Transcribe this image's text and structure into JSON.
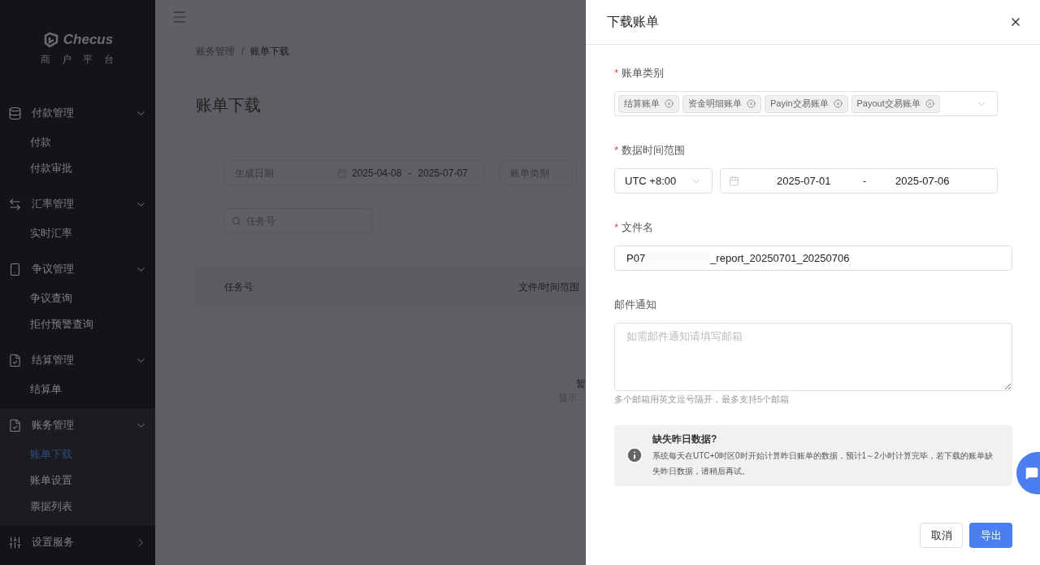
{
  "sidebar": {
    "logo": "Checus",
    "subtitle": "商户平台",
    "groups": [
      {
        "label": "付款管理",
        "expanded": true,
        "items": [
          {
            "label": "付款",
            "selected": false
          },
          {
            "label": "付款审批",
            "selected": false
          }
        ]
      },
      {
        "label": "汇率管理",
        "expanded": true,
        "items": [
          {
            "label": "实时汇率",
            "selected": false
          }
        ]
      },
      {
        "label": "争议管理",
        "expanded": true,
        "items": [
          {
            "label": "争议查询",
            "selected": false
          },
          {
            "label": "拒付预警查询",
            "selected": false
          }
        ]
      },
      {
        "label": "结算管理",
        "expanded": true,
        "items": [
          {
            "label": "结算单",
            "selected": false
          }
        ]
      },
      {
        "label": "账务管理",
        "expanded": true,
        "items": [
          {
            "label": "账单下载",
            "selected": true
          },
          {
            "label": "账单设置",
            "selected": false
          },
          {
            "label": "票据列表",
            "selected": false
          }
        ]
      },
      {
        "label": "设置服务",
        "expanded": false
      }
    ]
  },
  "breadcrumb": {
    "items": [
      "账务管理",
      "账单下载"
    ],
    "separator": "/"
  },
  "page": {
    "title": "账单下载",
    "filters": {
      "date_label": "生成日期",
      "date_start": "2025-04-08",
      "date_sep": "-",
      "date_end": "2025-07-07",
      "type_placeholder": "账单类别",
      "task_placeholder": "任务号"
    },
    "table": {
      "columns": [
        "任务号",
        "文件/时间范围"
      ],
      "empty_title": "暂",
      "empty_hint": "提示："
    }
  },
  "drawer": {
    "title": "下载账单",
    "required_mark": "*",
    "bill_type": {
      "label": "账单类别",
      "required": true,
      "tags": [
        "结算账单",
        "资金明细账单",
        "Payin交易账单",
        "Payout交易账单"
      ]
    },
    "time_range": {
      "label": "数据时间范围",
      "required": true,
      "timezone": "UTC +8:00",
      "start": "2025-07-01",
      "sep": "-",
      "end": "2025-07-06"
    },
    "file_name": {
      "label": "文件名",
      "required": true,
      "value_start": "P07",
      "value_end": "_report_20250701_20250706"
    },
    "email": {
      "label": "邮件通知",
      "required": false,
      "placeholder": "如需邮件通知请填写邮箱",
      "hint": "多个邮箱用英文逗号隔开，最多支持5个邮箱"
    },
    "notice": {
      "title": "缺失昨日数据?",
      "body": "系统每天在UTC+0时区0时开始计算昨日账单的数据，预计1～2小时计算完毕，若下载的账单缺失昨日数据，请稍后再试。"
    },
    "buttons": [
      {
        "label": "取消",
        "kind": "secondary"
      },
      {
        "label": "导出",
        "kind": "primary"
      }
    ]
  }
}
